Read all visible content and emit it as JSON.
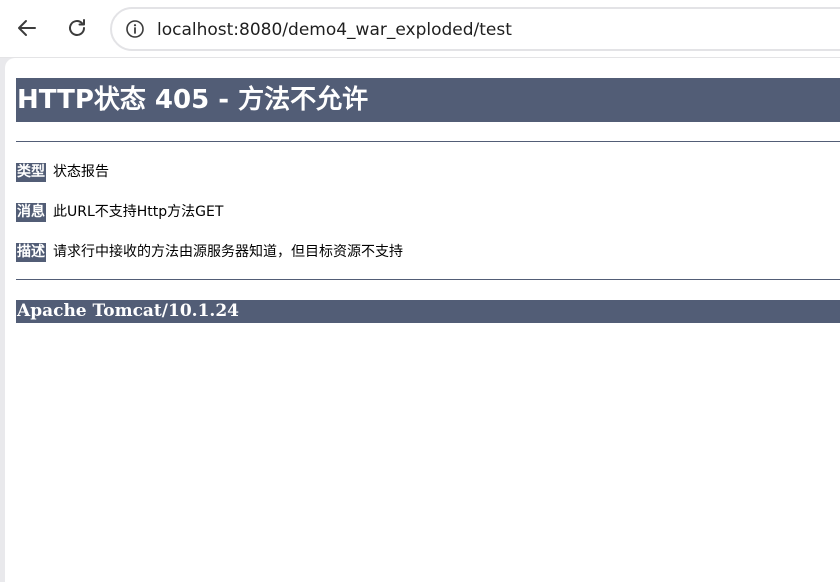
{
  "browser": {
    "url": "localhost:8080/demo4_war_exploded/test",
    "back_icon": "arrow-left-icon",
    "reload_icon": "reload-icon",
    "site_info_icon": "info-icon"
  },
  "page": {
    "title": "HTTP状态 405 - 方法不允许",
    "rows": [
      {
        "label": "类型",
        "value": "状态报告"
      },
      {
        "label": "消息",
        "value": "此URL不支持Http方法GET"
      },
      {
        "label": "描述",
        "value": "请求行中接收的方法由源服务器知道，但目标资源不支持"
      }
    ],
    "footer": "Apache Tomcat/10.1.24"
  },
  "colors": {
    "header_bg": "#525d76",
    "header_text": "#ffffff",
    "page_bg": "#ffffff",
    "chrome_bg": "#e9e9ec"
  }
}
